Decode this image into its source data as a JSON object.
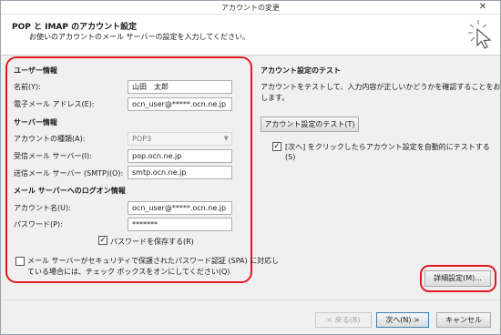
{
  "window": {
    "title": "アカウントの変更",
    "close_glyph": "✕"
  },
  "header": {
    "title": "POP と IMAP のアカウント設定",
    "subtitle": "お使いのアカウントのメール サーバーの設定を入力してください。"
  },
  "user_info": {
    "section": "ユーザー情報",
    "name_label": "名前(Y):",
    "name_value": "山田　太郎",
    "email_label": "電子メール アドレス(E):",
    "email_value": "ocn_user@*****.ocn.ne.jp"
  },
  "server_info": {
    "section": "サーバー情報",
    "account_type_label": "アカウントの種類(A):",
    "account_type_value": "POP3",
    "incoming_label": "受信メール サーバー(I):",
    "incoming_value": "pop.ocn.ne.jp",
    "outgoing_label": "送信メール サーバー (SMTP)(O):",
    "outgoing_value": "smtp.ocn.ne.jp"
  },
  "logon_info": {
    "section": "メール サーバーへのログオン情報",
    "account_name_label": "アカウント名(U):",
    "account_name_value": "ocn_user@*****.ocn.ne.jp",
    "password_label": "パスワード(P):",
    "password_value": "*******",
    "save_password_label": "パスワードを保存する(R)",
    "save_password_checked": true,
    "spa_label_line1": "メール サーバーがセキュリティで保護されたパスワード認証 (SPA) に対応し",
    "spa_label_line2": "ている場合には、チェック ボックスをオンにしてください(Q)",
    "spa_checked": false
  },
  "test": {
    "section": "アカウント設定のテスト",
    "desc_line1": "アカウントをテストして、入力内容が正しいかどうかを確認することをお勧め",
    "desc_line2": "します。",
    "test_button": "アカウント設定のテスト(T)",
    "auto_test_label_line1": "[次へ] をクリックしたらアカウント設定を自動的にテストする",
    "auto_test_label_line2": "(S)",
    "auto_test_checked": true
  },
  "buttons": {
    "advanced": "詳細設定(M)...",
    "back": "< 戻る(B)",
    "next": "次へ(N) >",
    "cancel": "キャンセル"
  },
  "colors": {
    "highlight": "#e01a22"
  }
}
